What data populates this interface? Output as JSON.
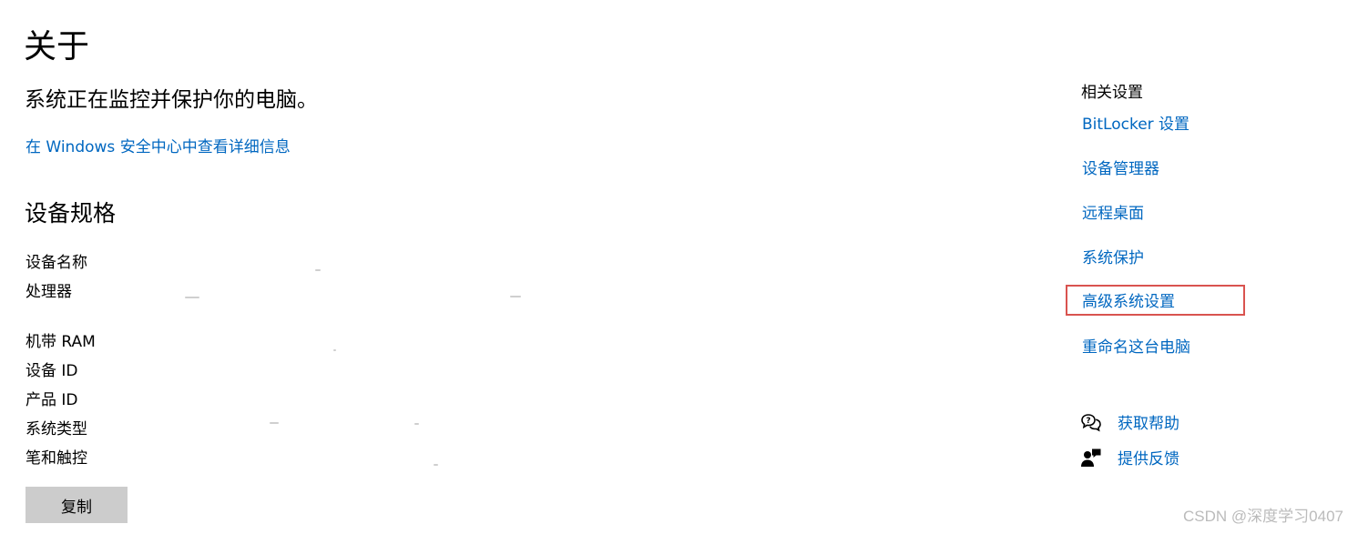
{
  "page": {
    "title": "关于",
    "protection_status": "系统正在监控并保护你的电脑。",
    "security_link": "在 Windows 安全中心中查看详细信息"
  },
  "device_specs": {
    "section_title": "设备规格",
    "labels": {
      "device_name": "设备名称",
      "processor": "处理器",
      "installed_ram": "机带 RAM",
      "device_id": "设备 ID",
      "product_id": "产品 ID",
      "system_type": "系统类型",
      "pen_touch": "笔和触控"
    },
    "copy_button": "复制"
  },
  "related_settings": {
    "heading": "相关设置",
    "links": {
      "bitlocker": "BitLocker 设置",
      "device_manager": "设备管理器",
      "remote_desktop": "远程桌面",
      "system_protection": "系统保护",
      "advanced_system_settings": "高级系统设置",
      "rename_pc": "重命名这台电脑"
    },
    "highlight_color": "#d9534f"
  },
  "help": {
    "get_help": "获取帮助",
    "feedback": "提供反馈",
    "get_help_icon": "chat-bubble-question-icon",
    "feedback_icon": "person-feedback-icon"
  },
  "colors": {
    "link": "#0067c0",
    "button_bg": "#cccccc",
    "text": "#000000"
  },
  "watermark": "CSDN @深度学习0407"
}
